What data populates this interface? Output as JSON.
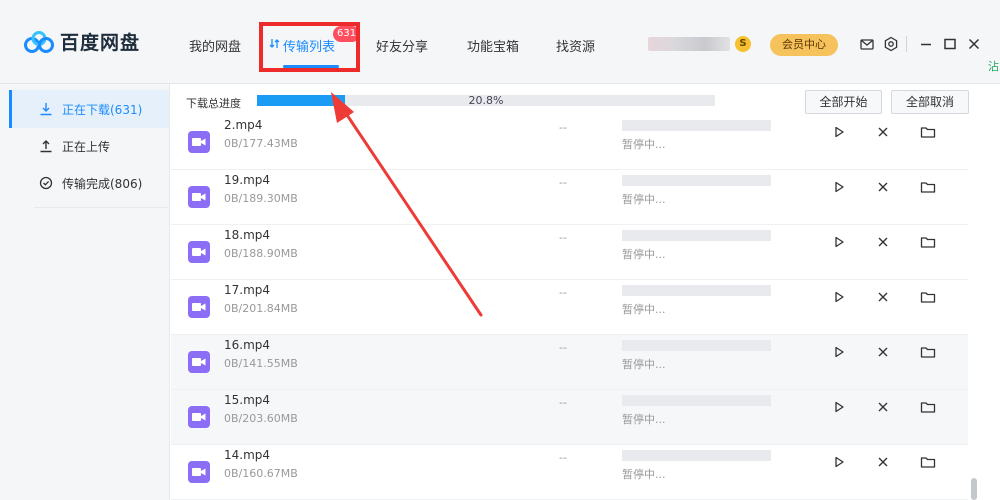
{
  "app": {
    "name": "百度网盘"
  },
  "nav": {
    "items": [
      {
        "label": "我的网盘"
      },
      {
        "label": "传输列表",
        "badge": "631",
        "active": true
      },
      {
        "label": "好友分享"
      },
      {
        "label": "功能宝箱"
      },
      {
        "label": "找资源"
      }
    ]
  },
  "header": {
    "coin_label": "S",
    "vip_label": "会员中心",
    "edge_text": "沾"
  },
  "sidebar": {
    "items": [
      {
        "label": "正在下载(631)",
        "icon": "download-icon",
        "active": true
      },
      {
        "label": "正在上传",
        "icon": "upload-icon"
      },
      {
        "label": "传输完成(806)",
        "icon": "check-circle-icon"
      }
    ]
  },
  "progress": {
    "label": "下载总进度",
    "percent_text": "20.8%",
    "percent": 20.8
  },
  "buttons": {
    "start_all": "全部开始",
    "cancel_all": "全部取消"
  },
  "files": [
    {
      "name": "2.mp4",
      "size": "0B/177.43MB",
      "speed": "--",
      "status": "暂停中..."
    },
    {
      "name": "19.mp4",
      "size": "0B/189.30MB",
      "speed": "--",
      "status": "暂停中..."
    },
    {
      "name": "18.mp4",
      "size": "0B/188.90MB",
      "speed": "--",
      "status": "暂停中..."
    },
    {
      "name": "17.mp4",
      "size": "0B/201.84MB",
      "speed": "--",
      "status": "暂停中..."
    },
    {
      "name": "16.mp4",
      "size": "0B/141.55MB",
      "speed": "--",
      "status": "暂停中..."
    },
    {
      "name": "15.mp4",
      "size": "0B/203.60MB",
      "speed": "--",
      "status": "暂停中..."
    },
    {
      "name": "14.mp4",
      "size": "0B/160.67MB",
      "speed": "--",
      "status": "暂停中..."
    }
  ],
  "colors": {
    "accent": "#1a8cff",
    "highlight": "#ee2b2b",
    "file_icon": "#8b6ef5",
    "progress": "#1a9cf4"
  }
}
